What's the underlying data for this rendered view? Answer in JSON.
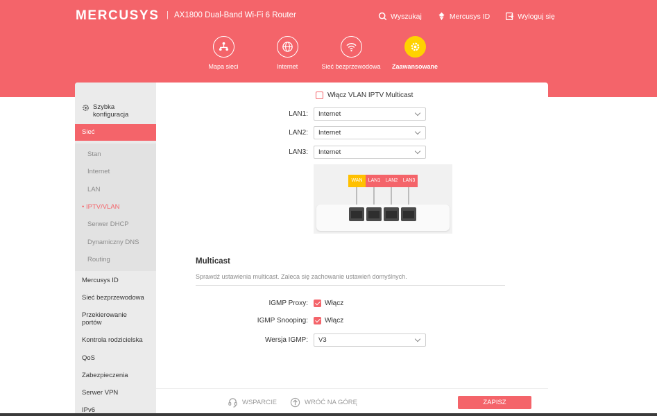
{
  "header": {
    "logo": "MERCUSYS",
    "model": "AX1800 Dual-Band Wi-Fi 6 Router",
    "search": "Wyszukaj",
    "mercusys_id": "Mercusys ID",
    "logout": "Wyloguj się"
  },
  "nav": [
    {
      "label": "Mapa sieci"
    },
    {
      "label": "Internet"
    },
    {
      "label": "Sieć bezprzewodowa"
    },
    {
      "label": "Zaawansowane"
    }
  ],
  "sidebar": {
    "quick_setup": "Szybka konfiguracja",
    "network": "Sieć",
    "sub": [
      "Stan",
      "Internet",
      "LAN",
      "• IPTV/VLAN",
      "Serwer DHCP",
      "Dynamiczny DNS",
      "Routing"
    ],
    "items": [
      "Mercusys ID",
      "Sieć bezprzewodowa",
      "Przekierowanie portów",
      "Kontrola rodzicielska",
      "QoS",
      "Zabezpieczenia",
      "Serwer VPN",
      "IPv6"
    ]
  },
  "iptv": {
    "vlan_multicast": "Włącz VLAN IPTV Multicast",
    "vlan_multicast_checked": false,
    "lan1_label": "LAN1:",
    "lan1_value": "Internet",
    "lan2_label": "LAN2:",
    "lan2_value": "Internet",
    "lan3_label": "LAN3:",
    "lan3_value": "Internet",
    "ports": [
      "WAN",
      "LAN1",
      "LAN2",
      "LAN3"
    ]
  },
  "multicast": {
    "title": "Multicast",
    "subtitle": "Sprawdź ustawienia multicast. Zaleca się zachowanie ustawień domyślnych.",
    "igmp_proxy_label": "IGMP Proxy:",
    "igmp_proxy_text": "Włącz",
    "igmp_snooping_label": "IGMP Snooping:",
    "igmp_snooping_text": "Włącz",
    "igmp_version_label": "Wersja IGMP:",
    "igmp_version_value": "V3"
  },
  "footer": {
    "support": "WSPARCIE",
    "back_to_top": "WRÓĆ NA GÓRĘ",
    "save": "ZAPISZ"
  },
  "colors": {
    "accent": "#f4646a",
    "active_nav": "#ffd200",
    "wan_port": "#ffc000"
  }
}
